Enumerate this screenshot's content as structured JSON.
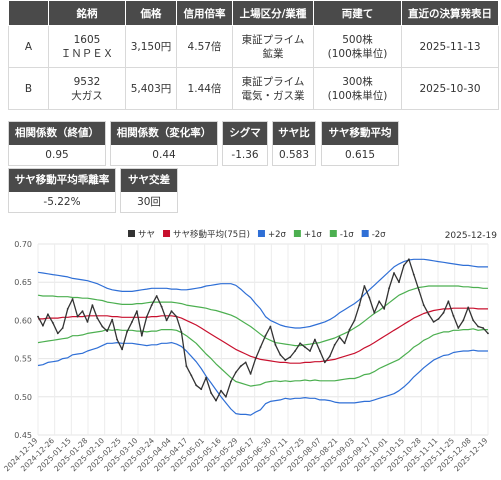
{
  "table": {
    "headers": [
      "",
      "銘柄",
      "価格",
      "信用倍率",
      "上場区分/業種",
      "両建て",
      "直近の決算発表日"
    ],
    "rows": [
      {
        "label": "A",
        "code": "1605",
        "name": "ＩＮＰＥＸ",
        "price": "3,150円",
        "margin": "4.57倍",
        "market": "東証プライム",
        "industry": "鉱業",
        "hedge": "500株",
        "hedge_unit": "(100株単位)",
        "earnings": "2025-11-13"
      },
      {
        "label": "B",
        "code": "9532",
        "name": "大ガス",
        "price": "5,403円",
        "margin": "1.44倍",
        "market": "東証プライム",
        "industry": "電気・ガス業",
        "hedge": "300株",
        "hedge_unit": "(100株単位)",
        "earnings": "2025-10-30"
      }
    ]
  },
  "metrics": {
    "corr_close": {
      "label": "相関係数（終値）",
      "value": "0.95"
    },
    "corr_change": {
      "label": "相関係数（変化率）",
      "value": "0.44"
    },
    "sigma": {
      "label": "シグマ",
      "value": "-1.36"
    },
    "spread_ratio": {
      "label": "サヤ比",
      "value": "0.583"
    },
    "spread_ma": {
      "label": "サヤ移動平均",
      "value": "0.615"
    },
    "spread_ma_dev": {
      "label": "サヤ移動平均乖離率",
      "value": "-5.22%"
    },
    "spread_cross": {
      "label": "サヤ交差",
      "value": "30回"
    }
  },
  "chart_data": {
    "type": "line",
    "date_label": "2025-12-19",
    "ylim": [
      0.45,
      0.7
    ],
    "yticks": [
      "0.45",
      "0.50",
      "0.55",
      "0.60",
      "0.65",
      "0.70"
    ],
    "xticks": [
      "2024-12-19",
      "2024-12-26",
      "2025-01-15",
      "2025-01-28",
      "2025-02-10",
      "2025-02-25",
      "2025-03-10",
      "2025-03-24",
      "2025-04-04",
      "2025-04-17",
      "2025-05-01",
      "2025-05-16",
      "2025-05-29",
      "2025-06-17",
      "2025-06-30",
      "2025-07-11",
      "2025-07-25",
      "2025-08-07",
      "2025-08-21",
      "2025-09-03",
      "2025-09-17",
      "2025-10-01",
      "2025-10-15",
      "2025-10-28",
      "2025-11-11",
      "2025-11-25",
      "2025-12-08",
      "2025-12-19"
    ],
    "legend": [
      {
        "name": "サヤ",
        "color": "#333333"
      },
      {
        "name": "サヤ移動平均(75日)",
        "color": "#c8102e"
      },
      {
        "name": "+2σ",
        "color": "#2f6fd6"
      },
      {
        "name": "+1σ",
        "color": "#4caf50"
      },
      {
        "name": "-1σ",
        "color": "#4caf50"
      },
      {
        "name": "-2σ",
        "color": "#2f6fd6"
      }
    ],
    "series": [
      {
        "name": "サヤ",
        "color": "#333333",
        "values": [
          0.605,
          0.593,
          0.608,
          0.597,
          0.583,
          0.59,
          0.615,
          0.628,
          0.605,
          0.612,
          0.598,
          0.62,
          0.603,
          0.592,
          0.586,
          0.601,
          0.575,
          0.562,
          0.585,
          0.598,
          0.612,
          0.58,
          0.605,
          0.62,
          0.632,
          0.618,
          0.6,
          0.612,
          0.605,
          0.585,
          0.54,
          0.528,
          0.515,
          0.51,
          0.525,
          0.505,
          0.495,
          0.508,
          0.5,
          0.52,
          0.532,
          0.54,
          0.545,
          0.53,
          0.55,
          0.565,
          0.58,
          0.592,
          0.568,
          0.555,
          0.548,
          0.552,
          0.56,
          0.57,
          0.565,
          0.56,
          0.575,
          0.56,
          0.545,
          0.553,
          0.568,
          0.578,
          0.57,
          0.588,
          0.6,
          0.62,
          0.645,
          0.63,
          0.61,
          0.625,
          0.615,
          0.642,
          0.662,
          0.65,
          0.672,
          0.68,
          0.66,
          0.64,
          0.62,
          0.608,
          0.598,
          0.602,
          0.61,
          0.625,
          0.606,
          0.59,
          0.6,
          0.617,
          0.6,
          0.592,
          0.59,
          0.583
        ]
      },
      {
        "name": "サヤ移動平均(75日)",
        "color": "#c8102e",
        "values": [
          0.602,
          0.602,
          0.603,
          0.603,
          0.603,
          0.604,
          0.604,
          0.605,
          0.605,
          0.605,
          0.606,
          0.606,
          0.606,
          0.606,
          0.606,
          0.605,
          0.605,
          0.604,
          0.604,
          0.604,
          0.604,
          0.604,
          0.604,
          0.605,
          0.605,
          0.606,
          0.606,
          0.606,
          0.605,
          0.603,
          0.6,
          0.597,
          0.594,
          0.59,
          0.586,
          0.582,
          0.578,
          0.574,
          0.57,
          0.566,
          0.562,
          0.559,
          0.556,
          0.553,
          0.551,
          0.549,
          0.548,
          0.547,
          0.546,
          0.545,
          0.545,
          0.544,
          0.544,
          0.544,
          0.545,
          0.545,
          0.546,
          0.546,
          0.547,
          0.548,
          0.549,
          0.551,
          0.553,
          0.555,
          0.557,
          0.56,
          0.564,
          0.567,
          0.571,
          0.575,
          0.579,
          0.583,
          0.587,
          0.591,
          0.595,
          0.599,
          0.603,
          0.606,
          0.609,
          0.611,
          0.613,
          0.614,
          0.615,
          0.615,
          0.616,
          0.616,
          0.616,
          0.616,
          0.616,
          0.615,
          0.615,
          0.615
        ]
      },
      {
        "name": "+2σ",
        "color": "#2f6fd6",
        "values": [
          0.663,
          0.662,
          0.661,
          0.66,
          0.659,
          0.658,
          0.657,
          0.655,
          0.654,
          0.653,
          0.652,
          0.65,
          0.648,
          0.645,
          0.642,
          0.64,
          0.639,
          0.638,
          0.638,
          0.638,
          0.639,
          0.64,
          0.641,
          0.642,
          0.642,
          0.642,
          0.642,
          0.641,
          0.641,
          0.64,
          0.64,
          0.641,
          0.642,
          0.643,
          0.645,
          0.646,
          0.647,
          0.648,
          0.648,
          0.648,
          0.646,
          0.641,
          0.635,
          0.63,
          0.622,
          0.615,
          0.605,
          0.6,
          0.597,
          0.594,
          0.592,
          0.591,
          0.59,
          0.59,
          0.591,
          0.592,
          0.594,
          0.596,
          0.598,
          0.601,
          0.605,
          0.61,
          0.614,
          0.618,
          0.622,
          0.627,
          0.634,
          0.64,
          0.646,
          0.652,
          0.658,
          0.664,
          0.67,
          0.674,
          0.677,
          0.679,
          0.68,
          0.68,
          0.68,
          0.679,
          0.678,
          0.677,
          0.676,
          0.675,
          0.674,
          0.673,
          0.672,
          0.672,
          0.671,
          0.67,
          0.67,
          0.67
        ]
      },
      {
        "name": "+1σ",
        "color": "#4caf50",
        "values": [
          0.633,
          0.632,
          0.632,
          0.632,
          0.631,
          0.631,
          0.631,
          0.63,
          0.63,
          0.629,
          0.629,
          0.628,
          0.627,
          0.626,
          0.624,
          0.623,
          0.622,
          0.621,
          0.621,
          0.621,
          0.622,
          0.622,
          0.623,
          0.624,
          0.624,
          0.624,
          0.624,
          0.624,
          0.623,
          0.622,
          0.62,
          0.619,
          0.618,
          0.617,
          0.616,
          0.614,
          0.613,
          0.611,
          0.609,
          0.607,
          0.604,
          0.6,
          0.596,
          0.592,
          0.587,
          0.582,
          0.577,
          0.574,
          0.571,
          0.57,
          0.569,
          0.568,
          0.567,
          0.567,
          0.568,
          0.569,
          0.57,
          0.571,
          0.573,
          0.575,
          0.577,
          0.58,
          0.583,
          0.586,
          0.59,
          0.594,
          0.599,
          0.604,
          0.609,
          0.613,
          0.618,
          0.623,
          0.628,
          0.633,
          0.636,
          0.639,
          0.641,
          0.643,
          0.644,
          0.645,
          0.645,
          0.645,
          0.645,
          0.645,
          0.645,
          0.645,
          0.644,
          0.644,
          0.643,
          0.643,
          0.642,
          0.642
        ]
      },
      {
        "name": "-1σ",
        "color": "#4caf50",
        "values": [
          0.571,
          0.572,
          0.573,
          0.574,
          0.575,
          0.576,
          0.577,
          0.58,
          0.58,
          0.581,
          0.583,
          0.584,
          0.585,
          0.586,
          0.588,
          0.587,
          0.588,
          0.587,
          0.587,
          0.587,
          0.586,
          0.586,
          0.585,
          0.586,
          0.586,
          0.588,
          0.588,
          0.588,
          0.587,
          0.584,
          0.58,
          0.575,
          0.57,
          0.563,
          0.556,
          0.55,
          0.543,
          0.537,
          0.531,
          0.525,
          0.52,
          0.518,
          0.516,
          0.514,
          0.515,
          0.516,
          0.519,
          0.52,
          0.521,
          0.52,
          0.521,
          0.52,
          0.521,
          0.521,
          0.522,
          0.521,
          0.522,
          0.521,
          0.521,
          0.521,
          0.521,
          0.522,
          0.523,
          0.524,
          0.524,
          0.526,
          0.529,
          0.53,
          0.533,
          0.537,
          0.54,
          0.543,
          0.546,
          0.549,
          0.554,
          0.559,
          0.565,
          0.569,
          0.574,
          0.577,
          0.581,
          0.583,
          0.585,
          0.585,
          0.587,
          0.587,
          0.588,
          0.588,
          0.589,
          0.587,
          0.588,
          0.588
        ]
      },
      {
        "name": "-2σ",
        "color": "#2f6fd6",
        "values": [
          0.541,
          0.542,
          0.545,
          0.546,
          0.547,
          0.55,
          0.551,
          0.555,
          0.556,
          0.557,
          0.56,
          0.562,
          0.564,
          0.567,
          0.57,
          0.57,
          0.571,
          0.57,
          0.57,
          0.57,
          0.569,
          0.568,
          0.567,
          0.568,
          0.568,
          0.57,
          0.57,
          0.571,
          0.569,
          0.566,
          0.56,
          0.553,
          0.546,
          0.537,
          0.527,
          0.518,
          0.509,
          0.5,
          0.492,
          0.484,
          0.478,
          0.477,
          0.477,
          0.476,
          0.48,
          0.483,
          0.491,
          0.494,
          0.495,
          0.496,
          0.498,
          0.497,
          0.498,
          0.498,
          0.499,
          0.498,
          0.498,
          0.496,
          0.496,
          0.495,
          0.493,
          0.492,
          0.492,
          0.492,
          0.492,
          0.493,
          0.494,
          0.494,
          0.496,
          0.498,
          0.5,
          0.502,
          0.504,
          0.508,
          0.513,
          0.519,
          0.526,
          0.532,
          0.538,
          0.543,
          0.548,
          0.551,
          0.554,
          0.555,
          0.558,
          0.559,
          0.56,
          0.56,
          0.561,
          0.56,
          0.56,
          0.56
        ]
      }
    ]
  }
}
